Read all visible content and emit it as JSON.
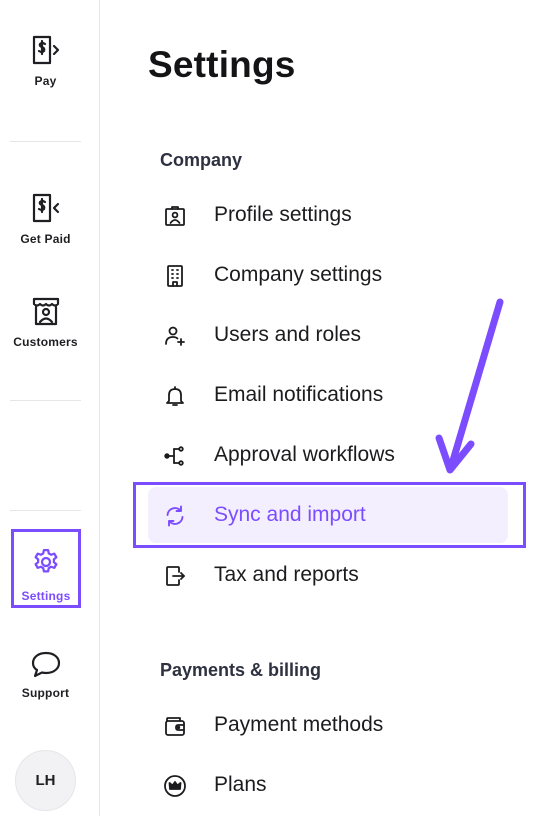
{
  "sidebar": {
    "items": [
      {
        "label": "Pay",
        "icon": "dollar-doc-icon"
      },
      {
        "label": "Get Paid",
        "icon": "dollar-doc-receive-icon"
      },
      {
        "label": "Customers",
        "icon": "store-person-icon"
      },
      {
        "label": "Settings",
        "icon": "gear-icon",
        "active": true
      },
      {
        "label": "Support",
        "icon": "chat-bubble-icon"
      }
    ],
    "avatar_initials": "LH"
  },
  "page": {
    "title": "Settings"
  },
  "sections": [
    {
      "title": "Company",
      "items": [
        {
          "label": "Profile settings",
          "icon": "profile-badge-icon"
        },
        {
          "label": "Company settings",
          "icon": "building-icon"
        },
        {
          "label": "Users and roles",
          "icon": "user-plus-icon"
        },
        {
          "label": "Email notifications",
          "icon": "bell-icon"
        },
        {
          "label": "Approval workflows",
          "icon": "workflow-icon"
        },
        {
          "label": "Sync and import",
          "icon": "sync-icon",
          "active": true
        },
        {
          "label": "Tax and reports",
          "icon": "export-doc-icon"
        }
      ]
    },
    {
      "title": "Payments & billing",
      "items": [
        {
          "label": "Payment methods",
          "icon": "wallet-icon"
        },
        {
          "label": "Plans",
          "icon": "crown-icon"
        }
      ]
    }
  ],
  "colors": {
    "accent": "#7c4dff",
    "active_bg": "#f3efff",
    "text": "#1c1c1f",
    "section_text": "#2d3140"
  }
}
